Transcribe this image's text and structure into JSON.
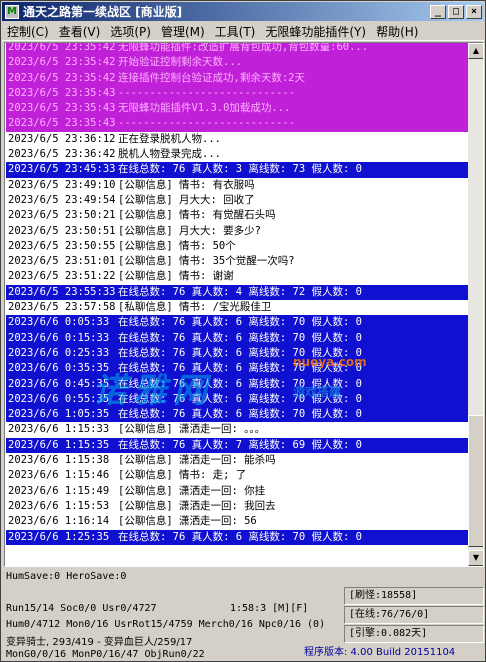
{
  "window": {
    "title": "通天之路第一续战区 [商业版]",
    "app_icon": "M",
    "buttons": {
      "minimize": "_",
      "maximize": "□",
      "close": "×"
    }
  },
  "menu": [
    "控制(C)",
    "查看(V)",
    "选项(P)",
    "管理(M)",
    "工具(T)",
    "无限蜂功能插件(Y)",
    "帮助(H)"
  ],
  "log": [
    {
      "style": "purple",
      "ts": "2023/6/5 23:35:42",
      "msg": "无限蜂功能插件:改造扩展背包成功,背包数量:60..."
    },
    {
      "style": "purple",
      "ts": "2023/6/5 23:35:42",
      "msg": "开始验证控制剩余天数..."
    },
    {
      "style": "purple",
      "ts": "2023/6/5 23:35:42",
      "msg": "连接插件控制台验证成功,剩余天数:2天"
    },
    {
      "style": "purple",
      "ts": "2023/6/5 23:35:43",
      "msg": "----------------------------"
    },
    {
      "style": "purple",
      "ts": "2023/6/5 23:35:43",
      "msg": "无限蜂功能插件V1.3.0加载成功..."
    },
    {
      "style": "purple",
      "ts": "2023/6/5 23:35:43",
      "msg": "----------------------------"
    },
    {
      "style": "plain",
      "ts": "2023/6/5 23:36:12",
      "msg": "正在登录脱机人物..."
    },
    {
      "style": "plain",
      "ts": "2023/6/5 23:36:42",
      "msg": "脱机人物登录完成..."
    },
    {
      "style": "blue",
      "ts": "2023/6/5 23:45:33",
      "msg": "在线总数: 76 真人数: 3 离线数: 73 假人数: 0"
    },
    {
      "style": "plain",
      "ts": "2023/6/5 23:49:10",
      "msg": "[公聊信息] 情书: 有衣服吗"
    },
    {
      "style": "plain",
      "ts": "2023/6/5 23:49:54",
      "msg": "[公聊信息] 月大大: 回收了"
    },
    {
      "style": "plain",
      "ts": "2023/6/5 23:50:21",
      "msg": "[公聊信息] 情书: 有觉醒石头吗"
    },
    {
      "style": "plain",
      "ts": "2023/6/5 23:50:51",
      "msg": "[公聊信息] 月大大: 要多少?"
    },
    {
      "style": "plain",
      "ts": "2023/6/5 23:50:55",
      "msg": "[公聊信息] 情书: 50个"
    },
    {
      "style": "plain",
      "ts": "2023/6/5 23:51:01",
      "msg": "[公聊信息] 情书: 35个觉醒一次吗?"
    },
    {
      "style": "plain",
      "ts": "2023/6/5 23:51:22",
      "msg": "[公聊信息] 情书: 谢谢"
    },
    {
      "style": "blue",
      "ts": "2023/6/5 23:55:33",
      "msg": "在线总数: 76 真人数: 4 离线数: 72 假人数: 0"
    },
    {
      "style": "plain",
      "ts": "2023/6/5 23:57:58",
      "msg": "[私聊信息] 情书: /宝光殿佳卫"
    },
    {
      "style": "blue",
      "ts": "2023/6/6 0:05:33",
      "msg": "在线总数: 76 真人数: 6 离线数: 70 假人数: 0"
    },
    {
      "style": "blue",
      "ts": "2023/6/6 0:15:33",
      "msg": "在线总数: 76 真人数: 6 离线数: 70 假人数: 0"
    },
    {
      "style": "blue",
      "ts": "2023/6/6 0:25:33",
      "msg": "在线总数: 76 真人数: 6 离线数: 70 假人数: 0"
    },
    {
      "style": "blue",
      "ts": "2023/6/6 0:35:35",
      "msg": "在线总数: 76 真人数: 6 离线数: 70 假人数: 0"
    },
    {
      "style": "blue",
      "ts": "2023/6/6 0:45:35",
      "msg": "在线总数: 76 真人数: 6 离线数: 70 假人数: 0"
    },
    {
      "style": "blue",
      "ts": "2023/6/6 0:55:35",
      "msg": "在线总数: 76 真人数: 6 离线数: 70 假人数: 0"
    },
    {
      "style": "blue",
      "ts": "2023/6/6 1:05:35",
      "msg": "在线总数: 76 真人数: 6 离线数: 70 假人数: 0"
    },
    {
      "style": "plain",
      "ts": "2023/6/6 1:15:33",
      "msg": "[公聊信息] 潇洒走一回: 。。。"
    },
    {
      "style": "blue",
      "ts": "2023/6/6 1:15:35",
      "msg": "在线总数: 76 真人数: 7 离线数: 69 假人数: 0"
    },
    {
      "style": "plain",
      "ts": "2023/6/6 1:15:38",
      "msg": "[公聊信息] 潇洒走一回: 能杀吗"
    },
    {
      "style": "plain",
      "ts": "2023/6/6 1:15:46",
      "msg": "[公聊信息] 情书: 走; 了"
    },
    {
      "style": "plain",
      "ts": "2023/6/6 1:15:49",
      "msg": "[公聊信息] 潇洒走一回: 你挂"
    },
    {
      "style": "plain",
      "ts": "2023/6/6 1:15:53",
      "msg": "[公聊信息] 潇洒走一回: 我回去"
    },
    {
      "style": "plain",
      "ts": "2023/6/6 1:16:14",
      "msg": "[公聊信息] 潇洒走一回: 56"
    },
    {
      "style": "blue",
      "ts": "2023/6/6 1:25:35",
      "msg": "在线总数: 76 真人数: 6 离线数: 70 假人数: 0"
    }
  ],
  "watermark": {
    "main": "诺雅网",
    "url": "nuoya.com",
    "sub": "游戏搭建"
  },
  "status": {
    "line1": "HumSave:0 HeroSave:0",
    "line2": "Run15/14 Soc0/0 Usr0/4727",
    "line2_time": "1:58:3 [M][F]",
    "line3": "Hum0/4712 Mon0/16 UsrRot15/4759 Merch0/16 Npc0/16 (0)",
    "line4": "变异骑士, 293/419 - 变异血巨人/259/17",
    "line5": "MonG0/0/16 MonP0/16/47 ObjRun0/22",
    "refresh": "[刷怪:18558]",
    "online": "[在线:76/76/0]",
    "engine": "[引擎:0.082天]",
    "version": "程序版本: 4.00 Build 20151104"
  }
}
